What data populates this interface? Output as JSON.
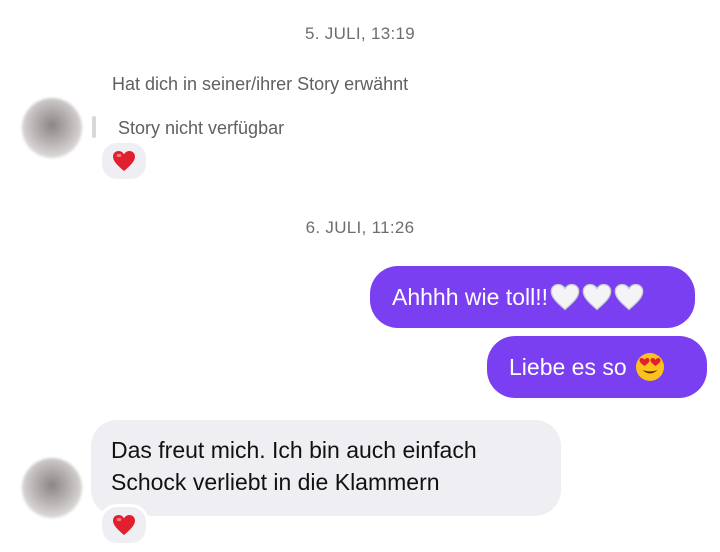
{
  "timestamps": {
    "first": "5. JULI, 13:19",
    "second": "6. JULI, 11:26"
  },
  "story": {
    "mention_text": "Hat dich in seiner/ihrer Story erwähnt",
    "unavailable_text": "Story nicht verfügbar",
    "reaction": "red-heart-icon"
  },
  "outgoing": [
    {
      "text": "Ahhhh wie toll!!",
      "icons": [
        "white-heart-icon",
        "white-heart-icon",
        "white-heart-icon"
      ]
    },
    {
      "text": "Liebe es so",
      "icons": [
        "heart-eyes-face-icon"
      ]
    }
  ],
  "incoming": {
    "line1": "Das freut mich. Ich bin auch einfach",
    "line2": "Schock verliebt in die Klammern",
    "reaction": "red-heart-icon"
  },
  "colors": {
    "outgoing_bubble": "#7b3ff2",
    "incoming_bubble": "#efeff3"
  }
}
